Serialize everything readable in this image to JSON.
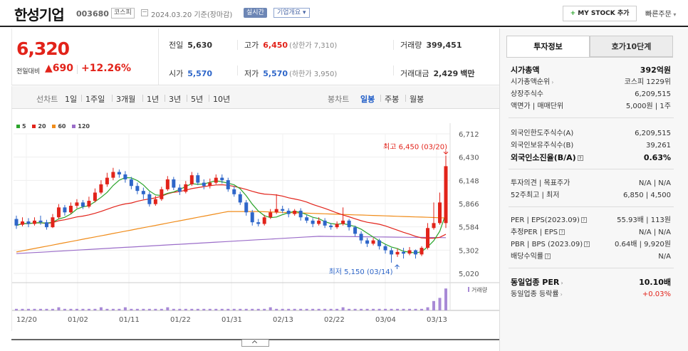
{
  "header": {
    "stock_name": "한성기업",
    "stock_code": "003680",
    "market": "코스피",
    "date_text": "2024.03.20 기준(장마감)",
    "realtime_label": "실시간",
    "overview_label": "기업개요",
    "mystock_label": "MY STOCK 추가",
    "quick_order_label": "빠른주문"
  },
  "summary": {
    "price": "6,320",
    "change_label": "전일대비",
    "change": "690",
    "change_pct": "+12.26%",
    "prev_close_label": "전일",
    "prev_close": "5,630",
    "high_label": "고가",
    "high": "6,450",
    "upper_limit": "(상한가 7,310)",
    "volume_label": "거래량",
    "volume": "399,451",
    "open_label": "시가",
    "open": "5,570",
    "low_label": "저가",
    "low": "5,570",
    "lower_limit": "(하한가 3,950)",
    "amount_label": "거래대금",
    "amount": "2,429",
    "amount_unit": "백만"
  },
  "period_tabs": {
    "candle_label": "선차트",
    "items": [
      "1일",
      "1주일",
      "3개월",
      "1년",
      "3년",
      "5년",
      "10년"
    ],
    "bong_label": "봉차트",
    "bong_items": [
      "일봉",
      "주봉",
      "월봉"
    ],
    "active_bong": "일봉"
  },
  "chart_data": {
    "type": "candlestick",
    "legend": [
      {
        "name": "5",
        "color": "#2ba42b"
      },
      {
        "name": "20",
        "color": "#e2231a"
      },
      {
        "name": "60",
        "color": "#f08c1a"
      },
      {
        "name": "120",
        "color": "#9b6dc9"
      }
    ],
    "y_ticks": [
      "6,712",
      "6,430",
      "6,148",
      "5,866",
      "5,584",
      "5,302",
      "5,020"
    ],
    "ylim": [
      5020,
      6712
    ],
    "x_ticks": [
      "12/20",
      "01/02",
      "01/11",
      "01/22",
      "01/31",
      "02/13",
      "02/22",
      "03/04",
      "03/13"
    ],
    "high_annotation": "최고 6,450 (03/20)",
    "low_annotation": "최저 5,150 (03/14)",
    "volume_label": "거래량",
    "candles": [
      [
        5680,
        5600,
        5720,
        5560
      ],
      [
        5610,
        5650,
        5700,
        5590
      ],
      [
        5650,
        5620,
        5690,
        5580
      ],
      [
        5620,
        5660,
        5700,
        5600
      ],
      [
        5660,
        5640,
        5720,
        5610
      ],
      [
        5640,
        5580,
        5670,
        5550
      ],
      [
        5580,
        5700,
        5740,
        5570
      ],
      [
        5700,
        5820,
        5860,
        5680
      ],
      [
        5820,
        5760,
        5850,
        5720
      ],
      [
        5760,
        5840,
        5880,
        5740
      ],
      [
        5840,
        5880,
        5920,
        5810
      ],
      [
        5880,
        5830,
        5910,
        5800
      ],
      [
        5830,
        5900,
        5950,
        5810
      ],
      [
        5900,
        6000,
        6050,
        5880
      ],
      [
        6000,
        6100,
        6150,
        5980
      ],
      [
        6100,
        6180,
        6240,
        6070
      ],
      [
        6180,
        6250,
        6300,
        6150
      ],
      [
        6250,
        6220,
        6280,
        6180
      ],
      [
        6220,
        6160,
        6260,
        6120
      ],
      [
        6160,
        6080,
        6190,
        6040
      ],
      [
        6080,
        6020,
        6120,
        5980
      ],
      [
        6020,
        5980,
        6060,
        5920
      ],
      [
        5980,
        5860,
        6010,
        5830
      ],
      [
        5860,
        5920,
        5960,
        5840
      ],
      [
        5920,
        6040,
        6070,
        5900
      ],
      [
        6040,
        6160,
        6200,
        6020
      ],
      [
        6160,
        6060,
        6190,
        6030
      ],
      [
        6060,
        6010,
        6100,
        5970
      ],
      [
        6010,
        6100,
        6140,
        5990
      ],
      [
        6100,
        6210,
        6250,
        6080
      ],
      [
        6210,
        6120,
        6240,
        6090
      ],
      [
        6120,
        6080,
        6160,
        6040
      ],
      [
        6080,
        6120,
        6170,
        6050
      ],
      [
        6120,
        6180,
        6220,
        6100
      ],
      [
        6180,
        6150,
        6220,
        6110
      ],
      [
        6150,
        6040,
        6180,
        6010
      ],
      [
        6040,
        5980,
        6080,
        5950
      ],
      [
        5980,
        5880,
        6010,
        5850
      ],
      [
        5880,
        5760,
        5910,
        5720
      ],
      [
        5760,
        5640,
        5790,
        5600
      ],
      [
        5640,
        5620,
        5680,
        5590
      ],
      [
        5620,
        5700,
        5730,
        5600
      ],
      [
        5700,
        5760,
        5800,
        5680
      ],
      [
        5760,
        5800,
        5980,
        5740
      ],
      [
        5800,
        5780,
        5840,
        5750
      ],
      [
        5780,
        5740,
        5810,
        5700
      ],
      [
        5740,
        5780,
        5800,
        5720
      ],
      [
        5780,
        5700,
        5810,
        5660
      ],
      [
        5700,
        5660,
        5730,
        5630
      ],
      [
        5660,
        5620,
        5690,
        5580
      ],
      [
        5620,
        5660,
        5700,
        5600
      ],
      [
        5660,
        5600,
        5690,
        5570
      ],
      [
        5600,
        5580,
        5630,
        5550
      ],
      [
        5580,
        5620,
        5650,
        5560
      ],
      [
        5620,
        5660,
        5820,
        5600
      ],
      [
        5660,
        5580,
        5680,
        5540
      ],
      [
        5580,
        5500,
        5600,
        5470
      ],
      [
        5500,
        5420,
        5530,
        5380
      ],
      [
        5420,
        5380,
        5450,
        5340
      ],
      [
        5380,
        5420,
        5450,
        5360
      ],
      [
        5420,
        5350,
        5440,
        5310
      ],
      [
        5350,
        5300,
        5370,
        5260
      ],
      [
        5300,
        5250,
        5330,
        5150
      ],
      [
        5250,
        5280,
        5320,
        5220
      ],
      [
        5280,
        5260,
        5330,
        5200
      ],
      [
        5260,
        5300,
        5340,
        5240
      ],
      [
        5300,
        5250,
        5310,
        5200
      ],
      [
        5250,
        5330,
        5350,
        5230
      ],
      [
        5330,
        5570,
        5630,
        5310
      ],
      [
        5570,
        5630,
        5880,
        5550
      ],
      [
        5630,
        5880,
        6000,
        5610
      ],
      [
        5630,
        6320,
        6450,
        5570
      ]
    ]
  },
  "panel": {
    "tab_active": "투자정보",
    "tab_inactive": "호가10단계",
    "rows1": [
      {
        "k": "시가총액",
        "v": "392억원",
        "bold": true
      },
      {
        "k": "시가총액순위",
        "v": "코스피 1229위",
        "arrow": true
      },
      {
        "k": "상장주식수",
        "v": "6,209,515"
      },
      {
        "k": "액면가 | 매매단위",
        "v": "5,000원 | 1주"
      }
    ],
    "rows2": [
      {
        "k": "외국인한도주식수(A)",
        "v": "6,209,515"
      },
      {
        "k": "외국인보유주식수(B)",
        "v": "39,261"
      },
      {
        "k": "외국인소진율(B/A)",
        "v": "0.63%",
        "bold": true,
        "q": true
      }
    ],
    "rows3": [
      {
        "k": "투자의견 | 목표주가",
        "v": "N/A | N/A"
      },
      {
        "k": "52주최고 | 최저",
        "v": "6,850 | 4,500"
      }
    ],
    "rows4": [
      {
        "k": "PER | EPS(2023.09)",
        "v": "55.93배 | 113원",
        "q": true
      },
      {
        "k": "추정PER | EPS",
        "v": "N/A | N/A",
        "q": true
      },
      {
        "k": "PBR | BPS (2023.09)",
        "v": "0.64배 | 9,920원",
        "q": true
      },
      {
        "k": "배당수익률",
        "v": "N/A",
        "q": true
      }
    ],
    "rows5": [
      {
        "k": "동일업종 PER",
        "v": "10.10배",
        "bold": true,
        "arrow": true
      },
      {
        "k": "동일업종 등락률",
        "v": "+0.03%",
        "red": true,
        "arrow": true
      }
    ]
  }
}
